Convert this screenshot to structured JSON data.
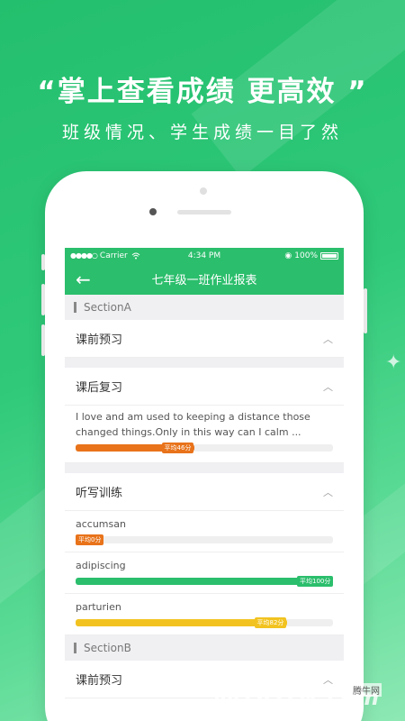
{
  "promo": {
    "headline": "“掌上查看成绩  更高效 ”",
    "subline": "班级情况、学生成绩一目了然"
  },
  "status_bar": {
    "signal": "●●●●○",
    "carrier": "Carrier",
    "wifi": "wifi-icon",
    "time": "4:34 PM",
    "lock": "◉",
    "battery": "100%"
  },
  "nav": {
    "back_icon": "←",
    "title": "七年级一班作业报表"
  },
  "sections": [
    {
      "title": "SectionA",
      "groups": [
        {
          "title": "课前预习",
          "chevron": "︿",
          "items": []
        },
        {
          "title": "课后复习",
          "chevron": "︿",
          "items": [
            {
              "text": "I love and am used to keeping a distance those changed things.Only in this way can I calm ...",
              "avg": 46,
              "avg_label": "平均46分",
              "color": "#e8731a"
            }
          ]
        },
        {
          "title": "听写训练",
          "chevron": "︿",
          "items": [
            {
              "text": "accumsan",
              "avg": 0,
              "avg_label": "平均0分",
              "color": "#e8731a"
            },
            {
              "text": "adipiscing",
              "avg": 100,
              "avg_label": "平均100分",
              "color": "#2bbe6c"
            },
            {
              "text": "parturien",
              "avg": 82,
              "avg_label": "平均82分",
              "color": "#f2c320"
            }
          ]
        }
      ]
    },
    {
      "title": "SectionB",
      "groups": [
        {
          "title": "课前预习",
          "chevron": "︿",
          "items": []
        }
      ]
    }
  ],
  "watermark": {
    "logo": "⋓",
    "text": "QQTN.com",
    "sub": "腾牛网"
  }
}
